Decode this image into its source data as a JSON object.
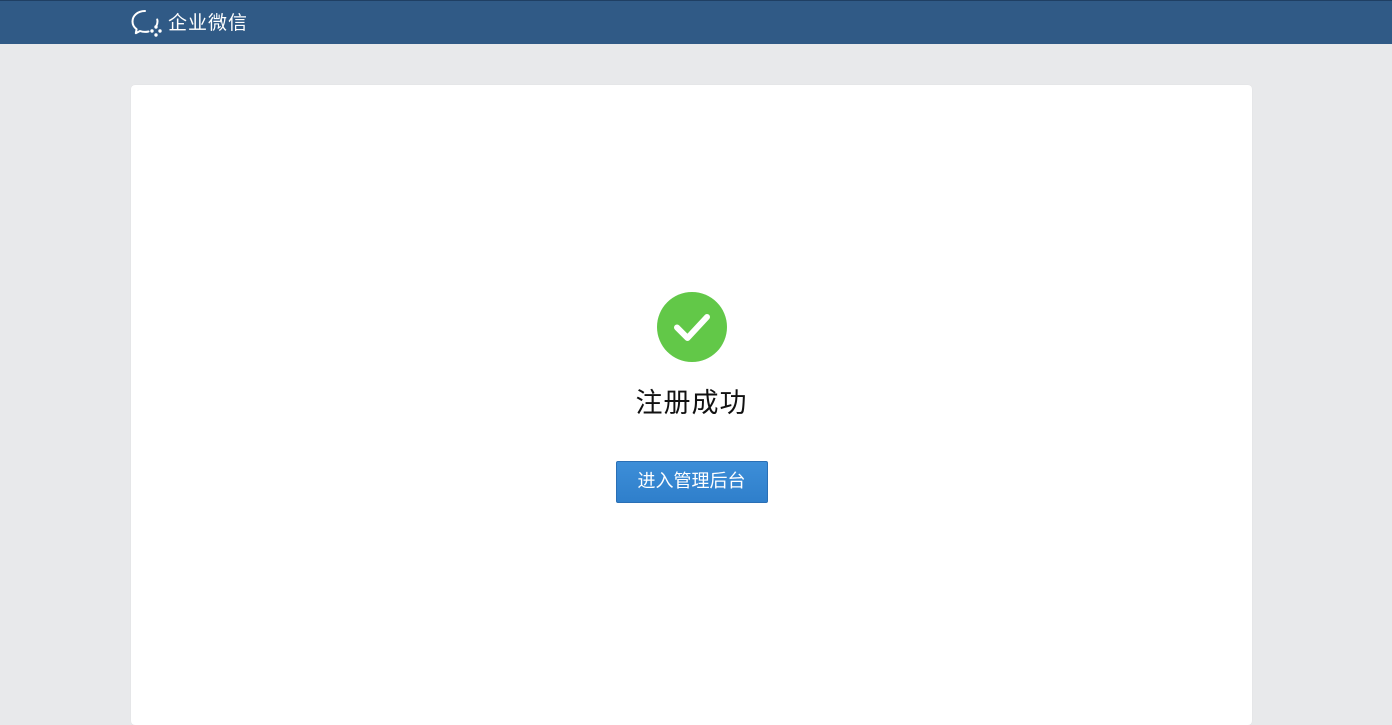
{
  "header": {
    "brand_name": "企业微信",
    "brand_icon": "wework-chat-bubble-icon",
    "background_color": "#305a86"
  },
  "main": {
    "status_icon": "check-circle-icon",
    "status_color": "#62c848",
    "title": "注册成功",
    "enter_button_label": "进入管理后台",
    "button_color": "#3587d2"
  }
}
